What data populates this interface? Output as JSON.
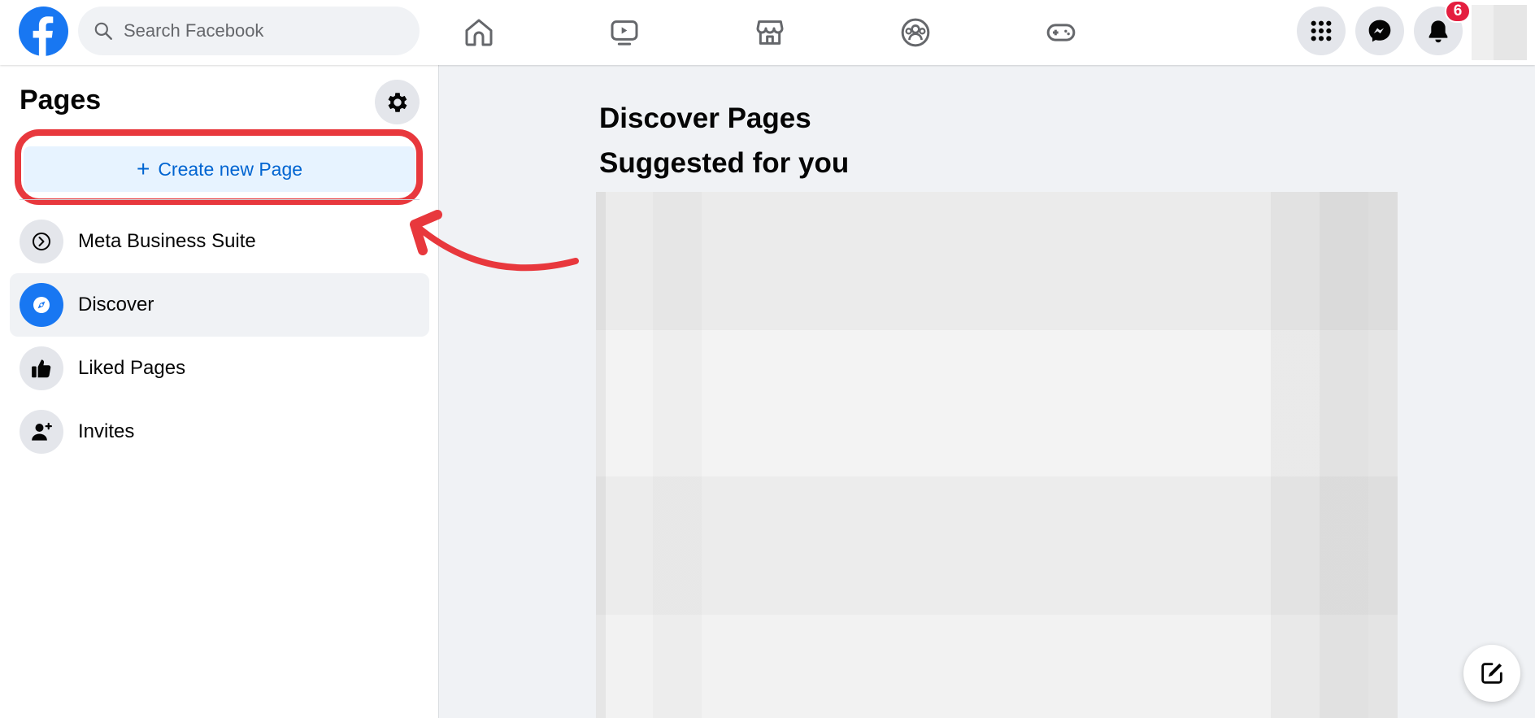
{
  "topbar": {
    "search_placeholder": "Search Facebook",
    "notification_count": "6",
    "nav_icons": [
      "home-icon",
      "watch-icon",
      "marketplace-icon",
      "groups-icon",
      "gaming-icon"
    ],
    "right_icons": [
      "menu-grid-icon",
      "messenger-icon",
      "bell-icon"
    ]
  },
  "sidebar": {
    "title": "Pages",
    "create_label": "Create new Page",
    "create_plus": "+",
    "items": [
      {
        "label": "Meta Business Suite",
        "icon": "meta-business-suite-icon",
        "active": false
      },
      {
        "label": "Discover",
        "icon": "compass-icon",
        "active": true
      },
      {
        "label": "Liked Pages",
        "icon": "thumbs-up-icon",
        "active": false
      },
      {
        "label": "Invites",
        "icon": "person-add-icon",
        "active": false
      }
    ]
  },
  "main": {
    "title": "Discover Pages",
    "subtitle": "Suggested for you"
  },
  "colors": {
    "brand": "#1877f2",
    "annotation": "#e8383d",
    "badge": "#e41e3f"
  }
}
